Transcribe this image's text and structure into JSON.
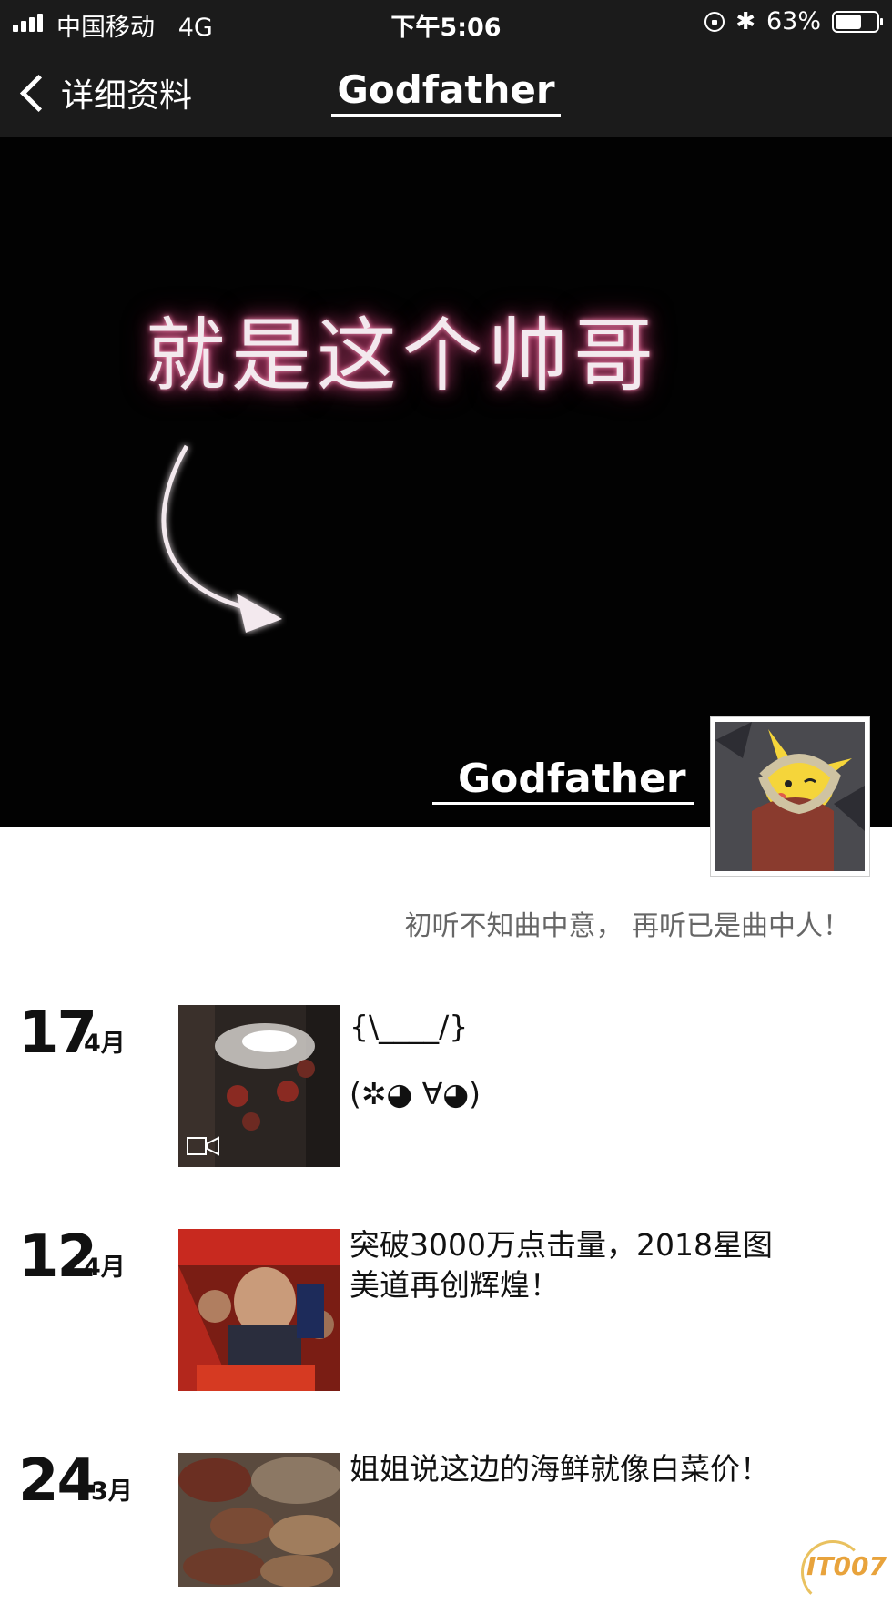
{
  "status_bar": {
    "carrier": "中国移动",
    "network": "4G",
    "time": "下午5:06",
    "battery_percent_label": "63%",
    "battery_level": 0.63,
    "icons": [
      "signal-icon",
      "rotation-lock-icon",
      "bluetooth-icon",
      "battery-icon"
    ]
  },
  "nav": {
    "back_label": "详细资料",
    "title": "Godfather"
  },
  "profile": {
    "cover_text": "就是这个帅哥",
    "name": "Godfather",
    "signature": "初听不知曲中意， 再听已是曲中人！"
  },
  "posts": [
    {
      "day": "17",
      "month": "4月",
      "text_lines": [
        "{\\____/}",
        "(✲◕ ∀◕)"
      ],
      "has_video": true
    },
    {
      "day": "12",
      "month": "4月",
      "text_lines": [
        "突破3000万点击量，2018星图",
        "美道再创辉煌！"
      ],
      "has_video": false
    },
    {
      "day": "24",
      "month": "3月",
      "text_lines": [
        "姐姐说这边的海鲜就像白菜价！"
      ],
      "has_video": false
    }
  ],
  "watermark": "IT007",
  "colors": {
    "nav_background": "#1b1b1b",
    "cover_background": "#020202",
    "glow": "#d6467d"
  }
}
